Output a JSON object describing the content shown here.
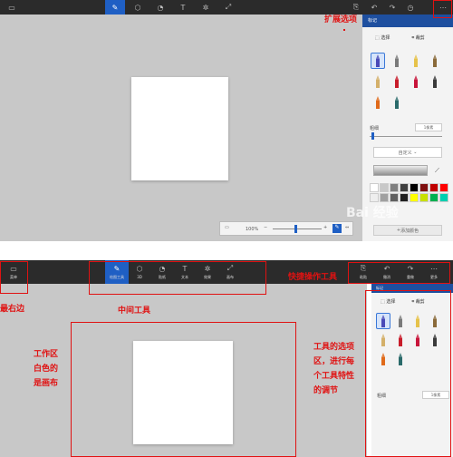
{
  "shot1": {
    "toolbar": {
      "tool_icons": [
        "brush-icon",
        "3d-icon",
        "sticker-icon",
        "text-icon",
        "effects-icon",
        "crop-icon"
      ]
    },
    "panel": {
      "title": "标记",
      "tab_select": "选择",
      "tab_crop": "裁剪",
      "thickness_label": "粗细",
      "thickness_value": "1像素",
      "color_dropdown": "自定义",
      "add_color": "添加颜色"
    },
    "status": {
      "zoom": "100%"
    },
    "palette": [
      "#ffffff",
      "#c8c8c8",
      "#808080",
      "#404040",
      "#000000",
      "#7f0f0f",
      "#c00000",
      "#ff0000",
      "#eeeeee",
      "#a0a0a0",
      "#606060",
      "#202020",
      "#ffff00",
      "#c8e000",
      "#00b050",
      "#00d0b0"
    ],
    "brush_colors": [
      "#4a4ab8",
      "#7a7a7a",
      "#e6c24a",
      "#8a6a3a",
      "#d4b06a",
      "#c81c2a",
      "#c8143a",
      "#3a3a3a",
      "#e06a1a",
      "#2a6a6a"
    ],
    "watermark": "Bai 经验"
  },
  "shot2": {
    "toolbar": {
      "menu_label": "菜单",
      "tools": [
        "绘图工具",
        "3D",
        "贴纸",
        "文本",
        "效果",
        "画布"
      ],
      "right_tools": [
        "粘贴",
        "撤消",
        "重做",
        "历史记录",
        "更多"
      ]
    },
    "panel": {
      "title": "标记",
      "tab_select": "选择",
      "tab_crop": "裁剪",
      "thickness_label": "粗细",
      "thickness_value": "1像素"
    },
    "brush_colors": [
      "#4a4ab8",
      "#7a7a7a",
      "#e6c24a",
      "#8a6a3a",
      "#d4b06a",
      "#c81c2a",
      "#c8143a",
      "#3a3a3a",
      "#e06a1a",
      "#2a6a6a"
    ]
  },
  "annotations": {
    "expand_options": "扩展选项",
    "far_right": "最右边",
    "middle_tools": "中间工具",
    "quick_tools": "快捷操作工具",
    "workspace": "工作区\n白色的\n是画布",
    "options_area": "工具的选项\n区，进行每\n个工具特性\n的调节"
  },
  "annotation_color": "#e01212",
  "accent_color": "#1f5fc4"
}
